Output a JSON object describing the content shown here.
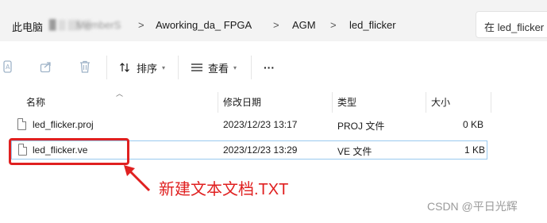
{
  "address_bar": {
    "crumb_pc": "此电脑",
    "crumb_blurred": "MemberS",
    "crumb_project": "Aworking_da_ FPGA",
    "crumb_agm": "AGM",
    "crumb_current": "led_flicker",
    "separator": ">",
    "search_placeholder": "在 led_flicker"
  },
  "toolbar": {
    "sort_label": "排序",
    "view_label": "查看",
    "more_label": "···"
  },
  "columns": {
    "name": "名称",
    "modified": "修改日期",
    "type": "类型",
    "size": "大小"
  },
  "files": [
    {
      "name": "led_flicker.proj",
      "modified": "2023/12/23 13:17",
      "type": "PROJ 文件",
      "size": "0 KB"
    },
    {
      "name": "led_flicker.ve",
      "modified": "2023/12/23 13:29",
      "type": "VE 文件",
      "size": "1 KB"
    }
  ],
  "annotation": {
    "text": "新建文本文档.TXT",
    "color": "#e02020"
  },
  "watermark": "CSDN @平日光辉"
}
